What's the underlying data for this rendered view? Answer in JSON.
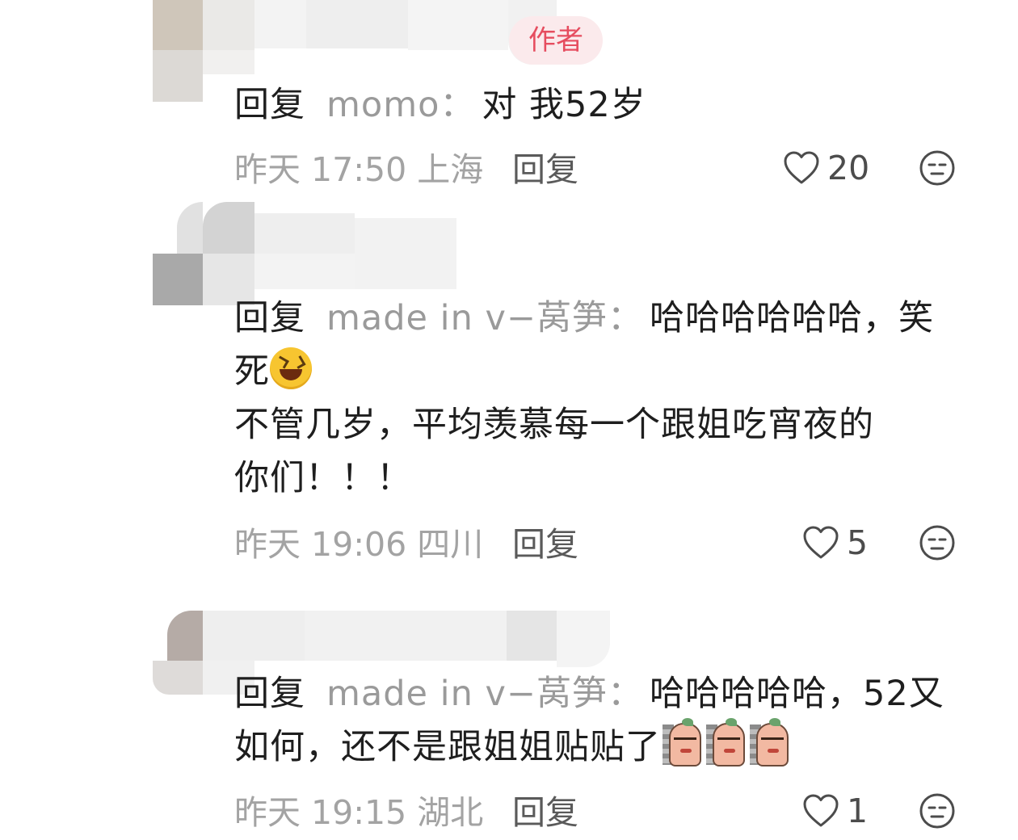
{
  "comments": [
    {
      "badge": "作者",
      "reply_prefix": "回复",
      "reply_user": "momo",
      "reply_colon": "：",
      "text_lines": [
        "对  我52岁"
      ],
      "time": "昨天 17:50 上海",
      "reply_label": "回复",
      "likes": "20"
    },
    {
      "reply_prefix": "回复",
      "reply_user": "made in v−莴笋",
      "reply_colon": "：",
      "text_line1": "哈哈哈哈哈哈，笑",
      "text_line2": "死",
      "emoji": "laughing-face",
      "text_line3": "不管几岁，平均羡慕每一个跟姐吃宵夜的",
      "text_line4": "你们！！！",
      "time": "昨天 19:06 四川",
      "reply_label": "回复",
      "likes": "5"
    },
    {
      "reply_prefix": "回复",
      "reply_user": "made in v−莴笋",
      "reply_colon": "：",
      "text_line1": "哈哈哈哈哈，52又",
      "text_line2": "如何，还不是跟姐姐贴贴了",
      "stickers": [
        "peek-sticker",
        "peek-sticker",
        "peek-sticker"
      ],
      "time": "昨天 19:15 湖北",
      "reply_label": "回复",
      "likes": "1"
    }
  ],
  "colors": {
    "badge_bg": "#fbeaec",
    "badge_text": "#e64d5f",
    "meta_text": "#a3a3a3",
    "username": "#9a9a9a",
    "body_text": "#1e1e1e"
  }
}
